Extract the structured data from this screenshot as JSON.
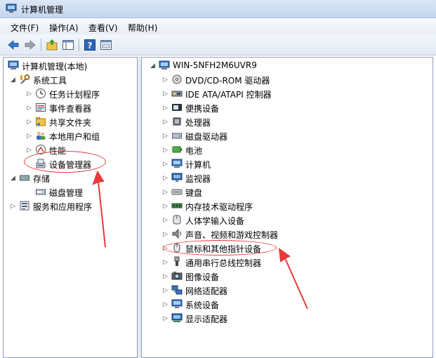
{
  "window": {
    "title": "计算机管理"
  },
  "menu": [
    {
      "label": "文件(F)"
    },
    {
      "label": "操作(A)"
    },
    {
      "label": "查看(V)"
    },
    {
      "label": "帮助(H)"
    }
  ],
  "toolbar": {
    "icons": [
      "back-arrow-icon",
      "forward-arrow-icon",
      "up-folder-icon",
      "show-hide-tree-icon",
      "help-icon",
      "properties-icon"
    ]
  },
  "left_tree": {
    "root": {
      "label": "计算机管理(本地)"
    },
    "system_tools": {
      "label": "系统工具"
    },
    "items": [
      {
        "label": "任务计划程序",
        "icon": "clock-icon"
      },
      {
        "label": "事件查看器",
        "icon": "event-viewer-icon"
      },
      {
        "label": "共享文件夹",
        "icon": "shared-folder-icon"
      },
      {
        "label": "本地用户和组",
        "icon": "users-icon"
      },
      {
        "label": "性能",
        "icon": "performance-icon"
      },
      {
        "label": "设备管理器",
        "icon": "device-manager-icon"
      }
    ],
    "storage": {
      "label": "存储"
    },
    "disk_mgmt": {
      "label": "磁盘管理"
    },
    "services": {
      "label": "服务和应用程序"
    }
  },
  "right_tree": {
    "computer": {
      "label": "WIN-5NFH2M6UVR9"
    },
    "categories": [
      {
        "label": "DVD/CD-ROM 驱动器",
        "icon": "dvd-icon"
      },
      {
        "label": "IDE ATA/ATAPI 控制器",
        "icon": "ide-controller-icon"
      },
      {
        "label": "便携设备",
        "icon": "portable-device-icon"
      },
      {
        "label": "处理器",
        "icon": "processor-icon"
      },
      {
        "label": "磁盘驱动器",
        "icon": "disk-drive-icon"
      },
      {
        "label": "电池",
        "icon": "battery-icon"
      },
      {
        "label": "计算机",
        "icon": "computer-icon"
      },
      {
        "label": "监视器",
        "icon": "monitor-icon"
      },
      {
        "label": "键盘",
        "icon": "keyboard-icon"
      },
      {
        "label": "内存技术驱动程序",
        "icon": "memory-icon"
      },
      {
        "label": "人体学输入设备",
        "icon": "hid-icon"
      },
      {
        "label": "声音、视频和游戏控制器",
        "icon": "sound-icon"
      },
      {
        "label": "鼠标和其他指针设备",
        "icon": "mouse-icon"
      },
      {
        "label": "通用串行总线控制器",
        "icon": "usb-icon"
      },
      {
        "label": "图像设备",
        "icon": "camera-icon"
      },
      {
        "label": "网络适配器",
        "icon": "network-icon"
      },
      {
        "label": "系统设备",
        "icon": "system-device-icon"
      },
      {
        "label": "显示适配器",
        "icon": "display-adapter-icon"
      }
    ]
  }
}
